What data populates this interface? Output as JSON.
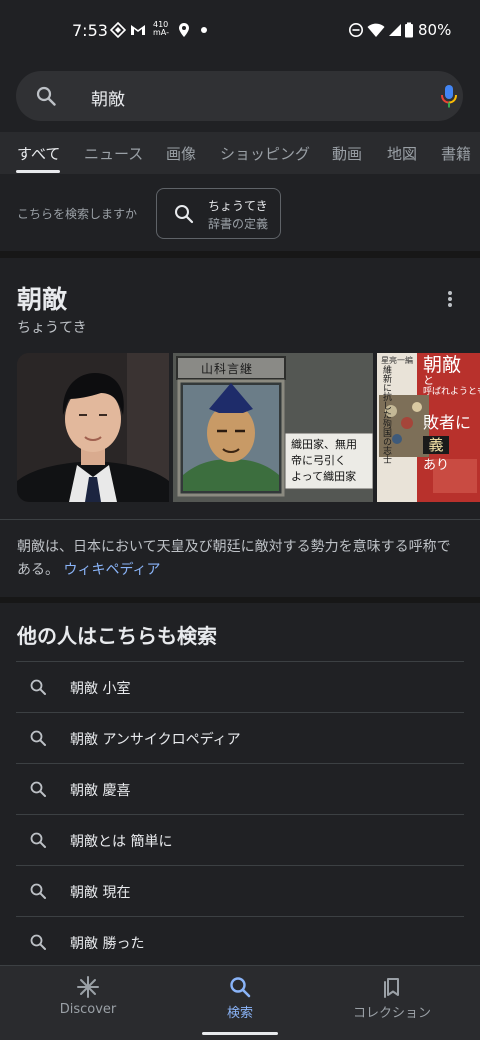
{
  "status_bar": {
    "time": "7:53",
    "data_rate_top": "410",
    "data_rate_bottom": "mA-",
    "battery": "80%"
  },
  "search": {
    "query": "朝敵",
    "search_icon": "search-icon",
    "mic_icon": "mic-icon"
  },
  "tabs": [
    "すべて",
    "ニュース",
    "画像",
    "ショッピング",
    "動画",
    "地図",
    "書籍"
  ],
  "suggestion": {
    "prompt": "こちらを検索しますか",
    "reading": "ちょうてき",
    "subtitle": "辞書の定義"
  },
  "knowledge_panel": {
    "title": "朝敵",
    "reading": "ちょうてき",
    "description": "朝敵は、日本において天皇及び朝廷に敵対する勢力を意味する呼称である。",
    "source_link": "ウィキペディア",
    "images": {
      "game_name_plate": "山科言継",
      "game_dialog_lines": [
        "織田家、無用",
        "帝に弓引く",
        "よって織田家"
      ],
      "book_title_lines": [
        "朝敵",
        "と",
        "呼ばれようとも",
        "敗者に",
        "義",
        "あり"
      ],
      "book_subtitle": "維新に抗した殉国の志士",
      "book_author": "星亮一編"
    }
  },
  "people_also_search": {
    "title": "他の人はこちらも検索",
    "items": [
      "朝敵 小室",
      "朝敵 アンサイクロペディア",
      "朝敵 慶喜",
      "朝敵とは 簡単に",
      "朝敵 現在",
      "朝敵 勝った"
    ]
  },
  "bottom_nav": {
    "items": [
      {
        "label": "Discover",
        "icon": "asterisk-icon"
      },
      {
        "label": "検索",
        "icon": "search-icon"
      },
      {
        "label": "コレクション",
        "icon": "bookmarks-icon"
      }
    ],
    "active_index": 1
  },
  "colors": {
    "background": "#202124",
    "accent": "#8ab4f8"
  }
}
